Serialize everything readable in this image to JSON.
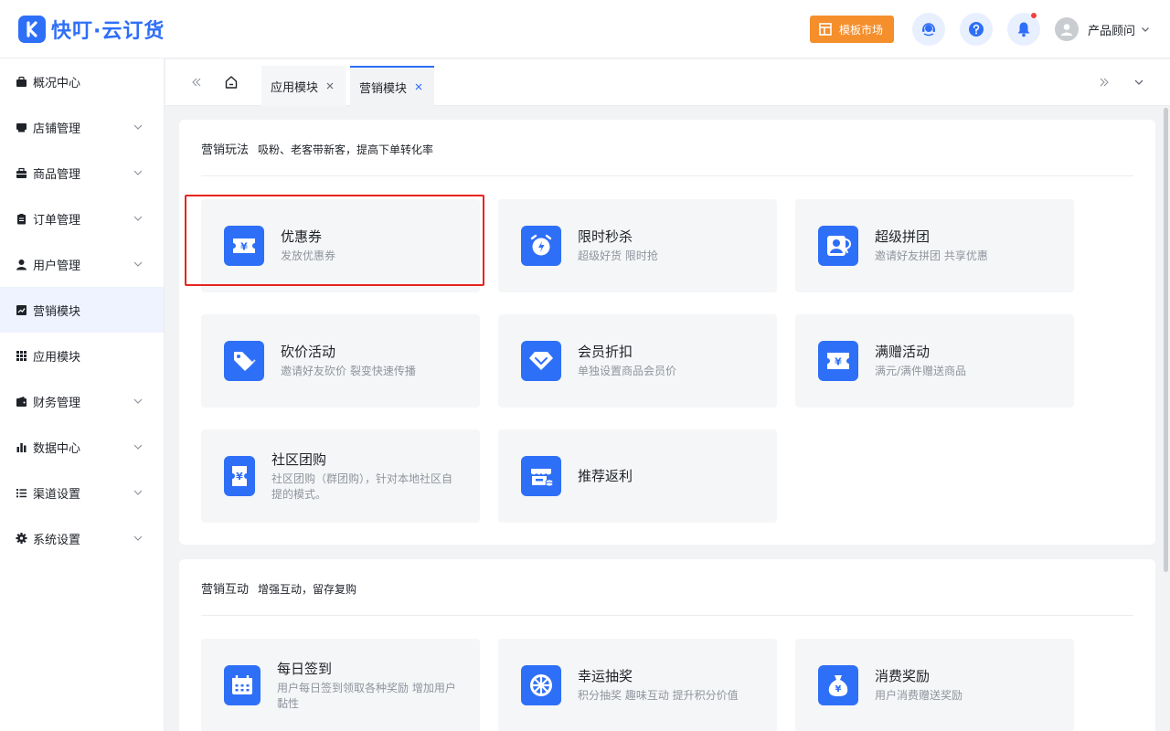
{
  "header": {
    "logo_text": "快叮·云订货",
    "market_label": "模板市场",
    "user_name": "产品顾问",
    "accent_color": "#2e6ff7",
    "market_color": "#f58f2c"
  },
  "sidebar": {
    "items": [
      {
        "label": "概况中心",
        "icon": "briefcase-icon",
        "has_chevron": false
      },
      {
        "label": "店铺管理",
        "icon": "store-icon",
        "has_chevron": true
      },
      {
        "label": "商品管理",
        "icon": "box-icon",
        "has_chevron": true
      },
      {
        "label": "订单管理",
        "icon": "clipboard-icon",
        "has_chevron": true
      },
      {
        "label": "用户管理",
        "icon": "user-icon",
        "has_chevron": true
      },
      {
        "label": "营销模块",
        "icon": "trend-chart-icon",
        "has_chevron": false,
        "active": true
      },
      {
        "label": "应用模块",
        "icon": "grid-icon",
        "has_chevron": false
      },
      {
        "label": "财务管理",
        "icon": "wallet-icon",
        "has_chevron": true
      },
      {
        "label": "数据中心",
        "icon": "bar-chart-icon",
        "has_chevron": true
      },
      {
        "label": "渠道设置",
        "icon": "list-icon",
        "has_chevron": true
      },
      {
        "label": "系统设置",
        "icon": "gear-icon",
        "has_chevron": true
      }
    ]
  },
  "tabs": [
    {
      "label": "应用模块",
      "active": false
    },
    {
      "label": "营销模块",
      "active": true
    }
  ],
  "sections": [
    {
      "title": "营销玩法",
      "subtitle": "吸粉、老客带新客，提高下单转化率",
      "cards": [
        {
          "title": "优惠券",
          "desc": "发放优惠券",
          "icon": "coupon-icon"
        },
        {
          "title": "限时秒杀",
          "desc": "超级好货 限时抢",
          "icon": "alarm-clock-icon"
        },
        {
          "title": "超级拼团",
          "desc": "邀请好友拼团 共享优惠",
          "icon": "group-users-icon"
        },
        {
          "title": "砍价活动",
          "desc": "邀请好友砍价 裂变快速传播",
          "icon": "price-tag-icon"
        },
        {
          "title": "会员折扣",
          "desc": "单独设置商品会员价",
          "icon": "diamond-icon"
        },
        {
          "title": "满赠活动",
          "desc": "满元/满件赠送商品",
          "icon": "gift-ticket-icon"
        },
        {
          "title": "社区团购",
          "desc": "社区团购（群团购），针对本地社区自提的模式。",
          "icon": "community-ticket-icon"
        },
        {
          "title": "推荐返利",
          "desc": "",
          "icon": "shop-rebate-icon"
        }
      ]
    },
    {
      "title": "营销互动",
      "subtitle": "增强互动，留存复购",
      "cards": [
        {
          "title": "每日签到",
          "desc": "用户每日签到领取各种奖励 增加用户黏性",
          "icon": "calendar-icon"
        },
        {
          "title": "幸运抽奖",
          "desc": "积分抽奖 趣味互动 提升积分价值",
          "icon": "lottery-wheel-icon"
        },
        {
          "title": "消费奖励",
          "desc": "用户消费赠送奖励",
          "icon": "money-bag-icon"
        }
      ]
    }
  ]
}
